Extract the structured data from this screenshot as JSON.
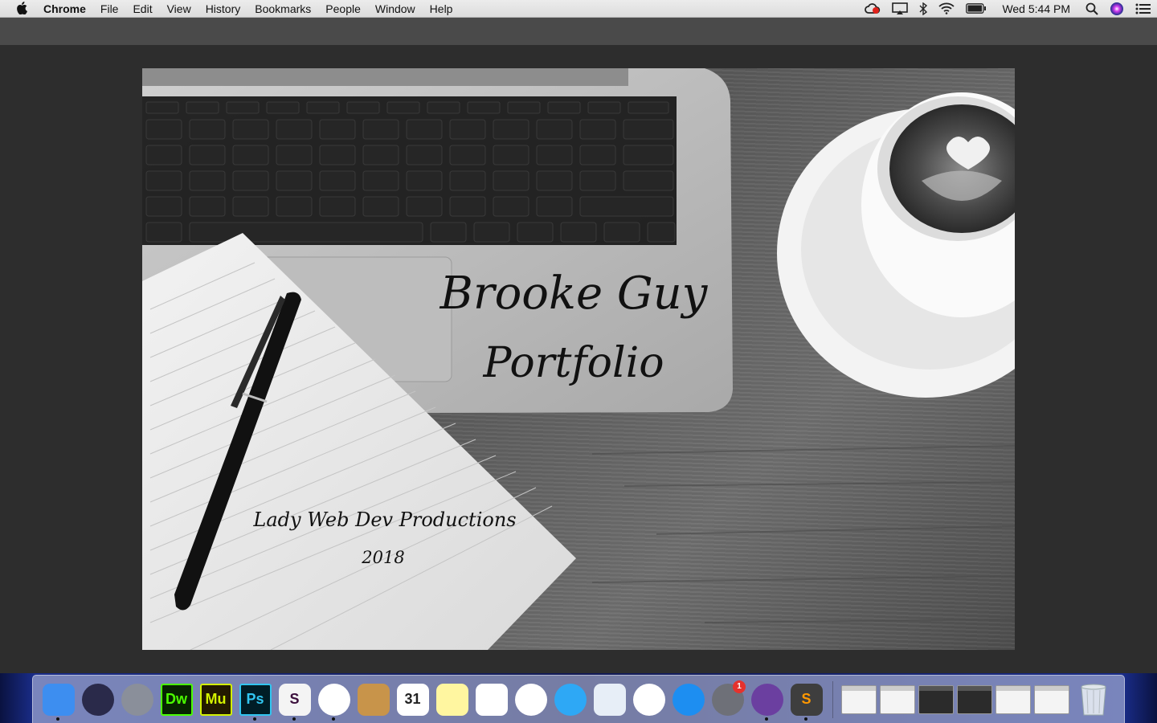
{
  "menubar": {
    "app_name": "Chrome",
    "menus": [
      "File",
      "Edit",
      "View",
      "History",
      "Bookmarks",
      "People",
      "Window",
      "Help"
    ],
    "clock": "Wed 5:44 PM",
    "status_icons": [
      "creative-cloud-icon",
      "airplay-icon",
      "bluetooth-icon",
      "wifi-icon",
      "battery-icon"
    ]
  },
  "hero": {
    "name": "Brooke Guy",
    "subtitle": "Portfolio",
    "company": "Lady Web Dev Productions",
    "year": "2018"
  },
  "dock": {
    "apps": [
      {
        "id": "finder",
        "icon": "finder-icon",
        "label": "",
        "bg": "#3d8ef0",
        "running": true
      },
      {
        "id": "siri",
        "icon": "siri-icon",
        "label": "",
        "bg": "#2a2a4a",
        "round": true,
        "running": false
      },
      {
        "id": "launchpad",
        "icon": "launchpad-icon",
        "label": "",
        "bg": "#8a8f9a",
        "round": true,
        "running": false
      },
      {
        "id": "dreamweaver",
        "icon": "dreamweaver-icon",
        "label": "Dw",
        "bg": "#072401",
        "fg": "#4bff00",
        "running": false
      },
      {
        "id": "muse",
        "icon": "muse-icon",
        "label": "Mu",
        "bg": "#231a00",
        "fg": "#d4f200",
        "running": false
      },
      {
        "id": "photoshop",
        "icon": "photoshop-icon",
        "label": "Ps",
        "bg": "#001d26",
        "fg": "#31c5f0",
        "running": true
      },
      {
        "id": "slack",
        "icon": "slack-icon",
        "label": "S",
        "bg": "#f4f4f4",
        "fg": "#3b0f3c",
        "running": true
      },
      {
        "id": "chrome",
        "icon": "chrome-icon",
        "label": "",
        "bg": "#ffffff",
        "round": true,
        "running": true
      },
      {
        "id": "contacts",
        "icon": "contacts-icon",
        "label": "",
        "bg": "#c8944a",
        "running": false
      },
      {
        "id": "calendar",
        "icon": "calendar-icon",
        "label": "31",
        "bg": "#ffffff",
        "fg": "#222",
        "running": false
      },
      {
        "id": "notes",
        "icon": "notes-icon",
        "label": "",
        "bg": "#fff6a0",
        "running": false
      },
      {
        "id": "reminders",
        "icon": "reminders-icon",
        "label": "",
        "bg": "#ffffff",
        "running": false
      },
      {
        "id": "photos",
        "icon": "photos-icon",
        "label": "",
        "bg": "#ffffff",
        "round": true,
        "running": false
      },
      {
        "id": "messages",
        "icon": "messages-icon",
        "label": "",
        "bg": "#2ea8f5",
        "round": true,
        "running": false
      },
      {
        "id": "preview",
        "icon": "preview-icon",
        "label": "",
        "bg": "#e7eef7",
        "running": false
      },
      {
        "id": "itunes",
        "icon": "itunes-icon",
        "label": "",
        "bg": "#ffffff",
        "round": true,
        "running": false
      },
      {
        "id": "appstore",
        "icon": "app-store-icon",
        "label": "",
        "bg": "#1d8ef1",
        "round": true,
        "running": false
      },
      {
        "id": "sysprefs",
        "icon": "system-preferences-icon",
        "label": "",
        "bg": "#6e7078",
        "round": true,
        "running": false,
        "badge": "1"
      },
      {
        "id": "github",
        "icon": "github-desktop-icon",
        "label": "",
        "bg": "#6b3fa0",
        "round": true,
        "running": true
      },
      {
        "id": "sublime",
        "icon": "sublime-text-icon",
        "label": "S",
        "bg": "#3e3e3e",
        "fg": "#ff9800",
        "running": true
      }
    ],
    "windows": [
      "light",
      "light",
      "dark",
      "dark",
      "light",
      "light"
    ]
  }
}
